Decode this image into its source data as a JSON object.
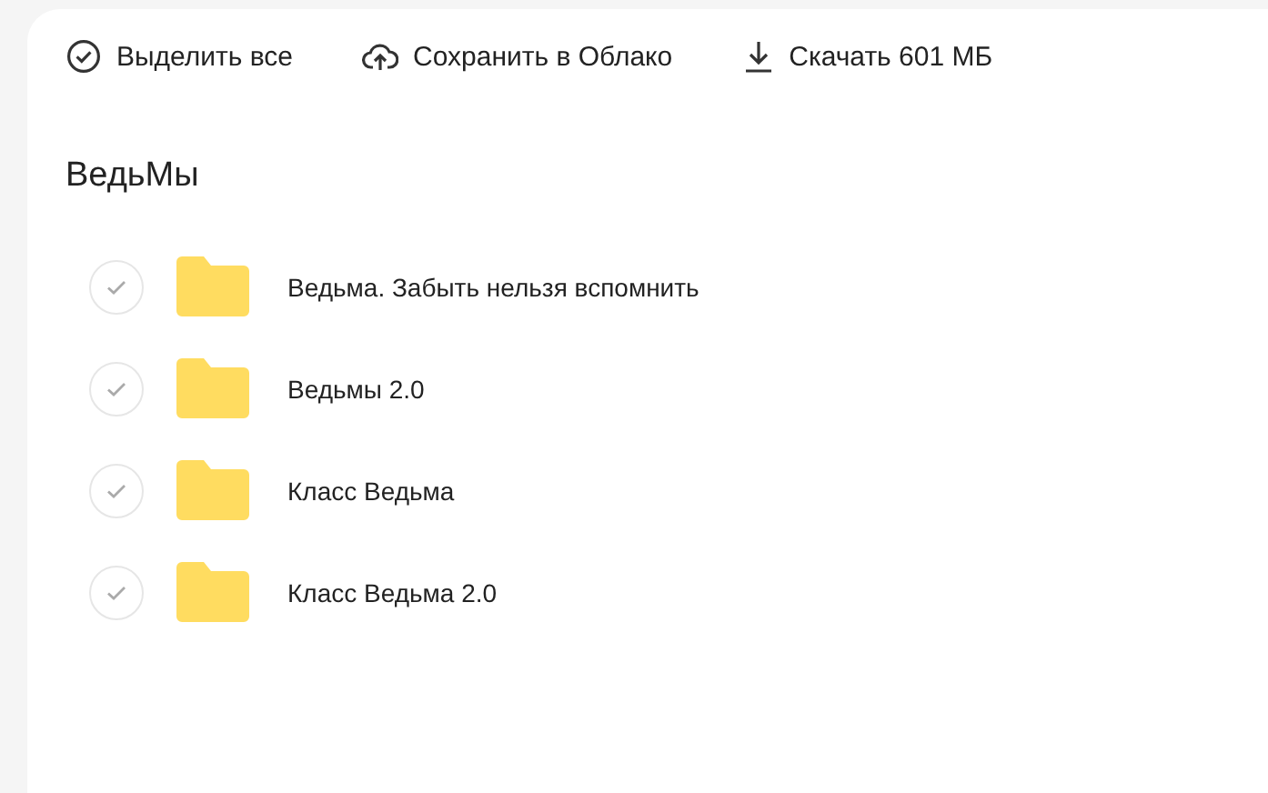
{
  "toolbar": [
    {
      "kind": "select",
      "label": "Выделить все"
    },
    {
      "kind": "cloud",
      "label": "Сохранить в Облако"
    },
    {
      "kind": "download",
      "label": "Скачать 601 МБ"
    }
  ],
  "title": "ВедьМы",
  "items": [
    {
      "name": "Ведьма. Забыть нельзя вспомнить",
      "checked": false
    },
    {
      "name": "Ведьмы 2.0",
      "checked": false
    },
    {
      "name": "Класс Ведьма",
      "checked": false
    },
    {
      "name": "Класс Ведьма 2.0",
      "checked": false
    }
  ]
}
